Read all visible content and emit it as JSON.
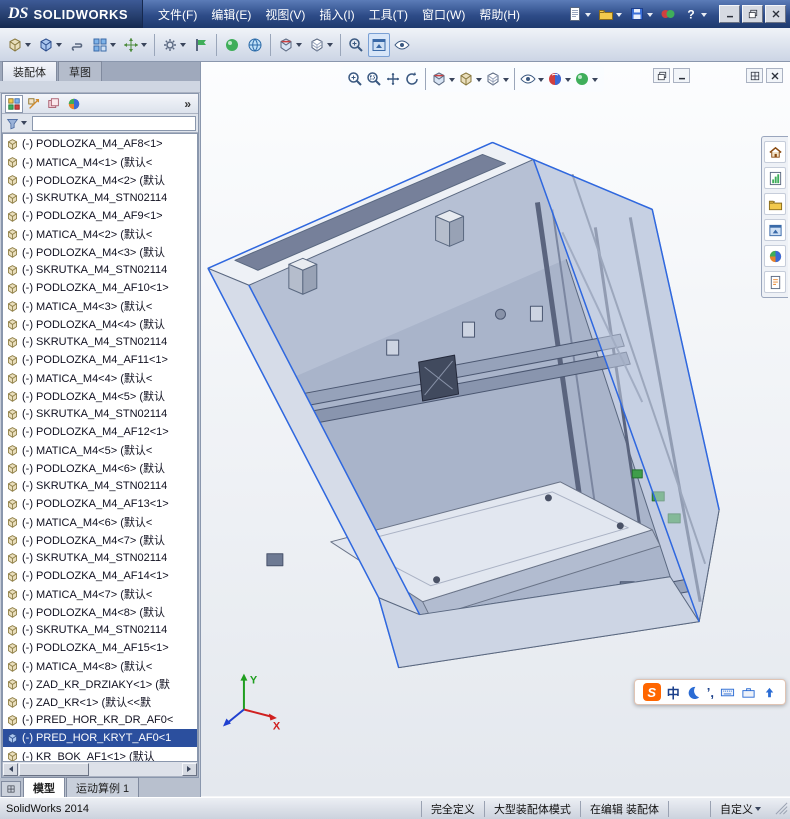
{
  "titlebar": {
    "logo": {
      "ds": "DS",
      "sw": "SOLIDWORKS"
    },
    "menus": [
      {
        "label": "文件(F)",
        "n": "menu-file"
      },
      {
        "label": "编辑(E)",
        "n": "menu-edit"
      },
      {
        "label": "视图(V)",
        "n": "menu-view"
      },
      {
        "label": "插入(I)",
        "n": "menu-insert"
      },
      {
        "label": "工具(T)",
        "n": "menu-tools"
      },
      {
        "label": "窗口(W)",
        "n": "menu-window"
      },
      {
        "label": "帮助(H)",
        "n": "menu-help"
      }
    ],
    "quick_icons": [
      {
        "n": "new-document",
        "i": "page",
        "dd": true
      },
      {
        "n": "open-document",
        "i": "folder",
        "dd": true
      },
      {
        "n": "save-document",
        "i": "save",
        "dd": true
      },
      {
        "n": "options-toggle",
        "i": "redgreen"
      },
      {
        "n": "help",
        "i": "help",
        "dd": true
      }
    ],
    "window_buttons": [
      {
        "n": "minimize",
        "i": "docmin"
      },
      {
        "n": "maximize",
        "i": "docrestore"
      },
      {
        "n": "close",
        "i": "docclose"
      }
    ]
  },
  "toolbar": {
    "buttons": [
      {
        "n": "insert-component",
        "i": "cube",
        "dd": true
      },
      {
        "n": "edit-component",
        "i": "cubeb",
        "dd": true
      },
      {
        "n": "mate",
        "i": "mate"
      },
      {
        "n": "component-pattern",
        "i": "pattern",
        "dd": true
      },
      {
        "n": "move-component",
        "i": "move",
        "dd": true
      },
      {
        "sep": true
      },
      {
        "n": "smart-fasteners",
        "i": "gear",
        "dd": true
      },
      {
        "n": "assembly-features",
        "i": "greenflag"
      },
      {
        "sep": true
      },
      {
        "n": "appearances",
        "i": "sphere2"
      },
      {
        "n": "3d-content-central",
        "i": "globe"
      },
      {
        "sep": true
      },
      {
        "n": "section-view",
        "i": "section",
        "dd": true
      },
      {
        "n": "display-style",
        "i": "displaystyle",
        "dd": true
      },
      {
        "sep": true
      },
      {
        "n": "zoom-to-fit",
        "i": "magfit"
      },
      {
        "n": "large-assembly-mode",
        "i": "viewpalette",
        "active": true
      },
      {
        "n": "view-settings",
        "i": "eye"
      }
    ]
  },
  "command_tabs": {
    "items": [
      {
        "label": "装配体",
        "active": true,
        "n": "commandtab-assembly"
      },
      {
        "label": "草图",
        "active": false,
        "n": "commandtab-sketch"
      }
    ]
  },
  "panel": {
    "header_icons": [
      {
        "n": "featuremanager-tab",
        "i": "fm",
        "active": true
      },
      {
        "n": "propertymanager-tab",
        "i": "pm"
      },
      {
        "n": "configurationmanager-tab",
        "i": "cm"
      },
      {
        "n": "displaymanager-tab",
        "i": "dm"
      }
    ],
    "overflow": "»",
    "tree": {
      "items": [
        {
          "text": "(-) PODLOZKA_M4_AF8<1>"
        },
        {
          "text": "(-) MATICA_M4<1> (默认<"
        },
        {
          "text": "(-) PODLOZKA_M4<2> (默认"
        },
        {
          "text": "(-) SKRUTKA_M4_STN02114"
        },
        {
          "text": "(-) PODLOZKA_M4_AF9<1>"
        },
        {
          "text": "(-) MATICA_M4<2> (默认<"
        },
        {
          "text": "(-) PODLOZKA_M4<3> (默认"
        },
        {
          "text": "(-) SKRUTKA_M4_STN02114"
        },
        {
          "text": "(-) PODLOZKA_M4_AF10<1>"
        },
        {
          "text": "(-) MATICA_M4<3> (默认<"
        },
        {
          "text": "(-) PODLOZKA_M4<4> (默认"
        },
        {
          "text": "(-) SKRUTKA_M4_STN02114"
        },
        {
          "text": "(-) PODLOZKA_M4_AF11<1>"
        },
        {
          "text": "(-) MATICA_M4<4> (默认<"
        },
        {
          "text": "(-) PODLOZKA_M4<5> (默认"
        },
        {
          "text": "(-) SKRUTKA_M4_STN02114"
        },
        {
          "text": "(-) PODLOZKA_M4_AF12<1>"
        },
        {
          "text": "(-) MATICA_M4<5> (默认<"
        },
        {
          "text": "(-) PODLOZKA_M4<6> (默认"
        },
        {
          "text": "(-) SKRUTKA_M4_STN02114"
        },
        {
          "text": "(-) PODLOZKA_M4_AF13<1>"
        },
        {
          "text": "(-) MATICA_M4<6> (默认<"
        },
        {
          "text": "(-) PODLOZKA_M4<7> (默认"
        },
        {
          "text": "(-) SKRUTKA_M4_STN02114"
        },
        {
          "text": "(-) PODLOZKA_M4_AF14<1>"
        },
        {
          "text": "(-) MATICA_M4<7> (默认<"
        },
        {
          "text": "(-) PODLOZKA_M4<8> (默认"
        },
        {
          "text": "(-) SKRUTKA_M4_STN02114"
        },
        {
          "text": "(-) PODLOZKA_M4_AF15<1>"
        },
        {
          "text": "(-) MATICA_M4<8> (默认<"
        },
        {
          "text": "(-) ZAD_KR_DRZIAKY<1> (默"
        },
        {
          "text": "(-) ZAD_KR<1> (默认<<默"
        },
        {
          "text": "(-) PRED_HOR_KR_DR_AF0<"
        },
        {
          "text": "(-) PRED_HOR_KRYT_AF0<1",
          "selected": true
        },
        {
          "text": "(-) KR_BOK_AF1<1> (默认"
        }
      ]
    }
  },
  "doc_tabs": {
    "items": [
      {
        "label": "模型",
        "active": true,
        "n": "tab-model"
      },
      {
        "label": "运动算例 1",
        "active": false,
        "n": "tab-motion-study-1"
      }
    ]
  },
  "viewport": {
    "headsup_icons": [
      {
        "n": "zoom-to-fit",
        "i": "magfit"
      },
      {
        "n": "zoom-to-area",
        "i": "magarea"
      },
      {
        "n": "pan",
        "i": "pan"
      },
      {
        "n": "rotate-view",
        "i": "rotate"
      },
      {
        "sep": true
      },
      {
        "n": "section-view",
        "i": "section",
        "dd": true
      },
      {
        "n": "view-orientation",
        "i": "cube",
        "dd": true
      },
      {
        "n": "display-style",
        "i": "displaystyle",
        "dd": true
      },
      {
        "sep": true
      },
      {
        "n": "hide-show-items",
        "i": "eye",
        "dd": true
      },
      {
        "n": "edit-appearance",
        "i": "sphere",
        "dd": true
      },
      {
        "n": "apply-scene",
        "i": "sphere2",
        "dd": true
      }
    ],
    "doc_controls_left": [
      {
        "n": "window-restore",
        "i": "docrestore"
      },
      {
        "n": "window-minimize",
        "i": "docmin"
      }
    ],
    "doc_controls_right": [
      {
        "n": "window-tile",
        "i": "docgrid"
      },
      {
        "n": "window-close",
        "i": "docclose"
      }
    ],
    "task_pane_icons": [
      {
        "n": "solidworks-resources",
        "i": "home"
      },
      {
        "n": "design-library",
        "i": "chart"
      },
      {
        "n": "file-explorer",
        "i": "folder"
      },
      {
        "n": "view-palette",
        "i": "viewpalette"
      },
      {
        "n": "appearances-scenes",
        "i": "dm"
      },
      {
        "n": "custom-properties",
        "i": "props"
      }
    ],
    "ime": {
      "logo": "S",
      "items": [
        {
          "t": "中",
          "n": "ime-chinese-mode"
        },
        {
          "i": "moon",
          "n": "ime-fullhalf-mode"
        },
        {
          "t": "’,",
          "n": "ime-punctuation"
        },
        {
          "i": "kb",
          "n": "ime-soft-keyboard"
        },
        {
          "i": "toolbox",
          "n": "ime-toolbox"
        },
        {
          "i": "uparrow",
          "n": "ime-skin"
        }
      ]
    },
    "triad": {
      "x": "X",
      "y": "Y"
    }
  },
  "statusbar": {
    "app": "SolidWorks 2014",
    "cells": [
      {
        "t": "完全定义",
        "n": "definition-status"
      },
      {
        "t": "大型装配体模式",
        "n": "large-assembly-mode-status"
      },
      {
        "t": "在编辑 装配体",
        "n": "editing-status"
      },
      {
        "t": "",
        "n": "empty-status"
      }
    ],
    "custom": {
      "t": "自定义",
      "n": "custom-toolbar-select"
    }
  },
  "colors": {
    "selection": "#2b4f9e",
    "model_edge_highlight": "#2f68e0",
    "model_panel": "#c3cce0",
    "ime_logo": "#ff6600"
  }
}
